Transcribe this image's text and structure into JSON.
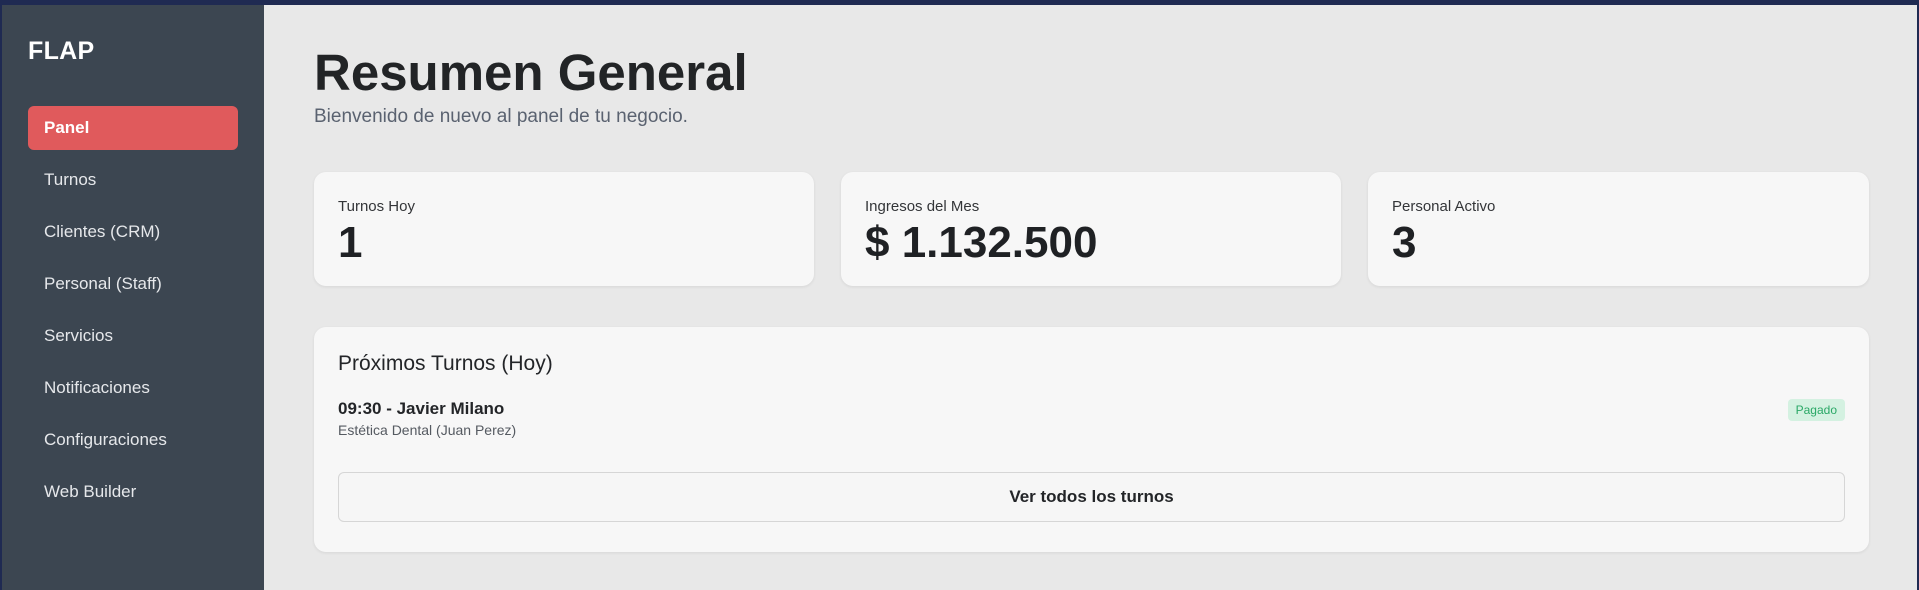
{
  "app": {
    "name": "FLAP"
  },
  "sidebar": {
    "items": [
      {
        "label": "Panel"
      },
      {
        "label": "Turnos"
      },
      {
        "label": "Clientes (CRM)"
      },
      {
        "label": "Personal (Staff)"
      },
      {
        "label": "Servicios"
      },
      {
        "label": "Notificaciones"
      },
      {
        "label": "Configuraciones"
      },
      {
        "label": "Web Builder"
      }
    ],
    "active": "Panel"
  },
  "header": {
    "title": "Resumen General",
    "subtitle": "Bienvenido de nuevo al panel de tu negocio."
  },
  "stats": [
    {
      "label": "Turnos Hoy",
      "value": "1"
    },
    {
      "label": "Ingresos del Mes",
      "value": "$ 1.132.500"
    },
    {
      "label": "Personal Activo",
      "value": "3"
    }
  ],
  "upcoming": {
    "title": "Próximos Turnos (Hoy)",
    "items": [
      {
        "heading": "09:30 - Javier Milano",
        "detail": "Estética Dental (Juan Perez)",
        "status": "Pagado"
      }
    ],
    "view_all_label": "Ver todos los turnos"
  },
  "colors": {
    "sidebar_bg": "#3c4651",
    "accent": "#e05a5c",
    "main_bg": "#e8e8e8",
    "card_bg": "#f7f7f7",
    "badge_bg": "#d4f1e1",
    "badge_text": "#2aa866"
  }
}
